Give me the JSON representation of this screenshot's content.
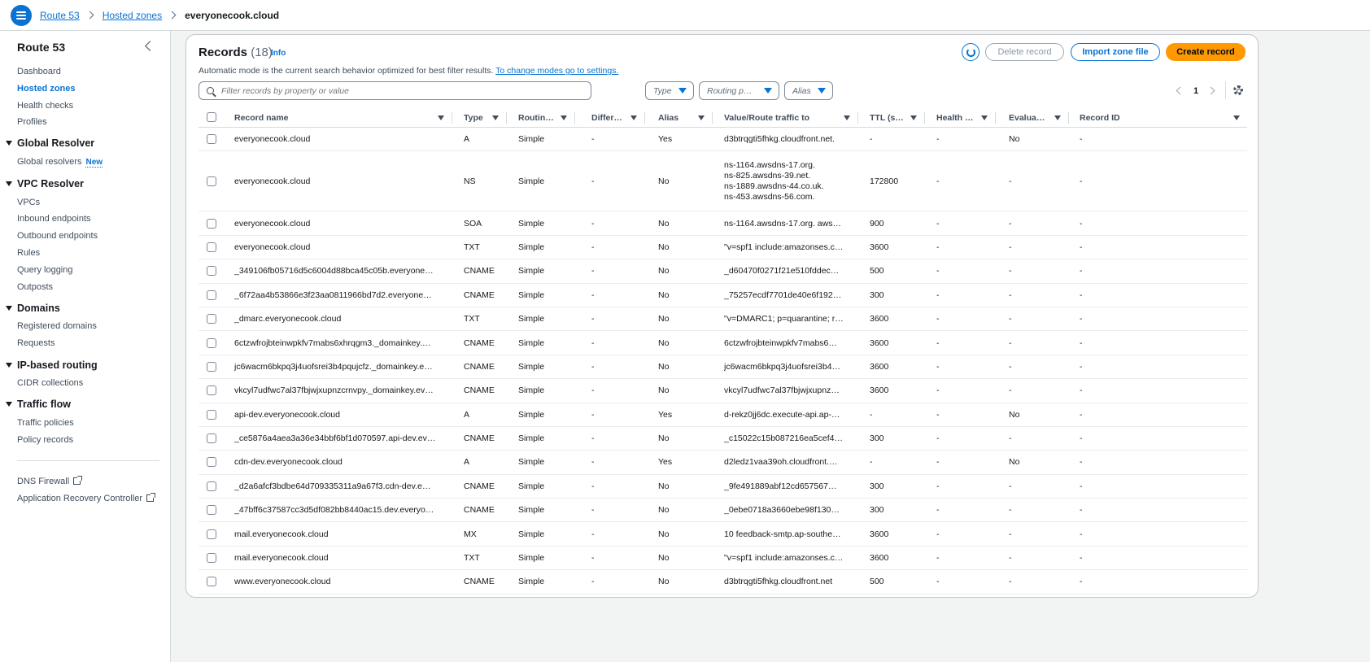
{
  "breadcrumb": [
    "Route 53",
    "Hosted zones",
    "everyonecook.cloud"
  ],
  "sidebar": {
    "title": "Route 53",
    "top_items": [
      "Dashboard",
      "Hosted zones",
      "Health checks",
      "Profiles"
    ],
    "sections": [
      {
        "title": "Global Resolver",
        "items": [
          "Global resolvers"
        ],
        "badge": "New"
      },
      {
        "title": "VPC Resolver",
        "items": [
          "VPCs",
          "Inbound endpoints",
          "Outbound endpoints",
          "Rules",
          "Query logging",
          "Outposts"
        ]
      },
      {
        "title": "Domains",
        "items": [
          "Registered domains",
          "Requests"
        ]
      },
      {
        "title": "IP-based routing",
        "items": [
          "CIDR collections"
        ]
      },
      {
        "title": "Traffic flow",
        "items": [
          "Traffic policies",
          "Policy records"
        ]
      }
    ],
    "external_items": [
      "DNS Firewall",
      "Application Recovery Controller"
    ]
  },
  "records": {
    "title": "Records",
    "count": "(18)",
    "info": "Info",
    "auto_text": "Automatic mode is the current search behavior optimized for best filter results.",
    "auto_link": "To change modes go to settings.",
    "buttons": {
      "delete": "Delete record",
      "import": "Import zone file",
      "create": "Create record"
    },
    "search_placeholder": "Filter records by property or value",
    "filters": [
      "Type",
      "Routing p…",
      "Alias"
    ],
    "page": "1",
    "columns": [
      "Record name",
      "Type",
      "Routin…",
      "Differ…",
      "Alias",
      "Value/Route traffic to",
      "TTL (s…",
      "Health …",
      "Evalua…",
      "Record ID"
    ],
    "rows": [
      {
        "name": "everyonecook.cloud",
        "type": "A",
        "routing": "Simple",
        "diff": "-",
        "alias": "Yes",
        "value": [
          "d3btrqgti5fhkg.cloudfront.net."
        ],
        "ttl": "-",
        "health": "-",
        "eval": "No",
        "id": "-"
      },
      {
        "name": "everyonecook.cloud",
        "type": "NS",
        "routing": "Simple",
        "diff": "-",
        "alias": "No",
        "value": [
          "ns-1164.awsdns-17.org.",
          "ns-825.awsdns-39.net.",
          "ns-1889.awsdns-44.co.uk.",
          "ns-453.awsdns-56.com."
        ],
        "ttl": "172800",
        "health": "-",
        "eval": "-",
        "id": "-"
      },
      {
        "name": "everyonecook.cloud",
        "type": "SOA",
        "routing": "Simple",
        "diff": "-",
        "alias": "No",
        "value": [
          "ns-1164.awsdns-17.org. aws…"
        ],
        "ttl": "900",
        "health": "-",
        "eval": "-",
        "id": "-"
      },
      {
        "name": "everyonecook.cloud",
        "type": "TXT",
        "routing": "Simple",
        "diff": "-",
        "alias": "No",
        "value": [
          "\"v=spf1 include:amazonses.c…"
        ],
        "ttl": "3600",
        "health": "-",
        "eval": "-",
        "id": "-"
      },
      {
        "name": "_349106fb05716d5c6004d88bca45c05b.everyone…",
        "type": "CNAME",
        "routing": "Simple",
        "diff": "-",
        "alias": "No",
        "value": [
          "_d60470f0271f21e510fddec…"
        ],
        "ttl": "500",
        "health": "-",
        "eval": "-",
        "id": "-"
      },
      {
        "name": "_6f72aa4b53866e3f23aa0811966bd7d2.everyone…",
        "type": "CNAME",
        "routing": "Simple",
        "diff": "-",
        "alias": "No",
        "value": [
          "_75257ecdf7701de40e6f192…"
        ],
        "ttl": "300",
        "health": "-",
        "eval": "-",
        "id": "-"
      },
      {
        "name": "_dmarc.everyonecook.cloud",
        "type": "TXT",
        "routing": "Simple",
        "diff": "-",
        "alias": "No",
        "value": [
          "\"v=DMARC1; p=quarantine; r…"
        ],
        "ttl": "3600",
        "health": "-",
        "eval": "-",
        "id": "-"
      },
      {
        "name": "6ctzwfrojbteinwpkfv7mabs6xhrqgm3._domainkey.…",
        "type": "CNAME",
        "routing": "Simple",
        "diff": "-",
        "alias": "No",
        "value": [
          "6ctzwfrojbteinwpkfv7mabs6…"
        ],
        "ttl": "3600",
        "health": "-",
        "eval": "-",
        "id": "-"
      },
      {
        "name": "jc6wacm6bkpq3j4uofsrei3b4pqujcfz._domainkey.e…",
        "type": "CNAME",
        "routing": "Simple",
        "diff": "-",
        "alias": "No",
        "value": [
          "jc6wacm6bkpq3j4uofsrei3b4…"
        ],
        "ttl": "3600",
        "health": "-",
        "eval": "-",
        "id": "-"
      },
      {
        "name": "vkcyl7udfwc7al37fbjwjxupnzcrnvpy._domainkey.ev…",
        "type": "CNAME",
        "routing": "Simple",
        "diff": "-",
        "alias": "No",
        "value": [
          "vkcyl7udfwc7al37fbjwjxupnz…"
        ],
        "ttl": "3600",
        "health": "-",
        "eval": "-",
        "id": "-"
      },
      {
        "name": "api-dev.everyonecook.cloud",
        "type": "A",
        "routing": "Simple",
        "diff": "-",
        "alias": "Yes",
        "value": [
          "d-rekz0jj6dc.execute-api.ap-…"
        ],
        "ttl": "-",
        "health": "-",
        "eval": "No",
        "id": "-"
      },
      {
        "name": "_ce5876a4aea3a36e34bbf6bf1d070597.api-dev.ev…",
        "type": "CNAME",
        "routing": "Simple",
        "diff": "-",
        "alias": "No",
        "value": [
          "_c15022c15b087216ea5cef4…"
        ],
        "ttl": "300",
        "health": "-",
        "eval": "-",
        "id": "-"
      },
      {
        "name": "cdn-dev.everyonecook.cloud",
        "type": "A",
        "routing": "Simple",
        "diff": "-",
        "alias": "Yes",
        "value": [
          "d2ledz1vaa39oh.cloudfront.…"
        ],
        "ttl": "-",
        "health": "-",
        "eval": "No",
        "id": "-"
      },
      {
        "name": "_d2a6afcf3bdbe64d709335311a9a67f3.cdn-dev.e…",
        "type": "CNAME",
        "routing": "Simple",
        "diff": "-",
        "alias": "No",
        "value": [
          "_9fe491889abf12cd657567…"
        ],
        "ttl": "300",
        "health": "-",
        "eval": "-",
        "id": "-"
      },
      {
        "name": "_47bff6c37587cc3d5df082bb8440ac15.dev.everyo…",
        "type": "CNAME",
        "routing": "Simple",
        "diff": "-",
        "alias": "No",
        "value": [
          "_0ebe0718a3660ebe98f130…"
        ],
        "ttl": "300",
        "health": "-",
        "eval": "-",
        "id": "-"
      },
      {
        "name": "mail.everyonecook.cloud",
        "type": "MX",
        "routing": "Simple",
        "diff": "-",
        "alias": "No",
        "value": [
          "10 feedback-smtp.ap-southe…"
        ],
        "ttl": "3600",
        "health": "-",
        "eval": "-",
        "id": "-"
      },
      {
        "name": "mail.everyonecook.cloud",
        "type": "TXT",
        "routing": "Simple",
        "diff": "-",
        "alias": "No",
        "value": [
          "\"v=spf1 include:amazonses.c…"
        ],
        "ttl": "3600",
        "health": "-",
        "eval": "-",
        "id": "-"
      },
      {
        "name": "www.everyonecook.cloud",
        "type": "CNAME",
        "routing": "Simple",
        "diff": "-",
        "alias": "No",
        "value": [
          "d3btrqgti5fhkg.cloudfront.net"
        ],
        "ttl": "500",
        "health": "-",
        "eval": "-",
        "id": "-"
      }
    ]
  },
  "colors": {
    "accent": "#0972d3",
    "primary_button": "#ff9900"
  }
}
